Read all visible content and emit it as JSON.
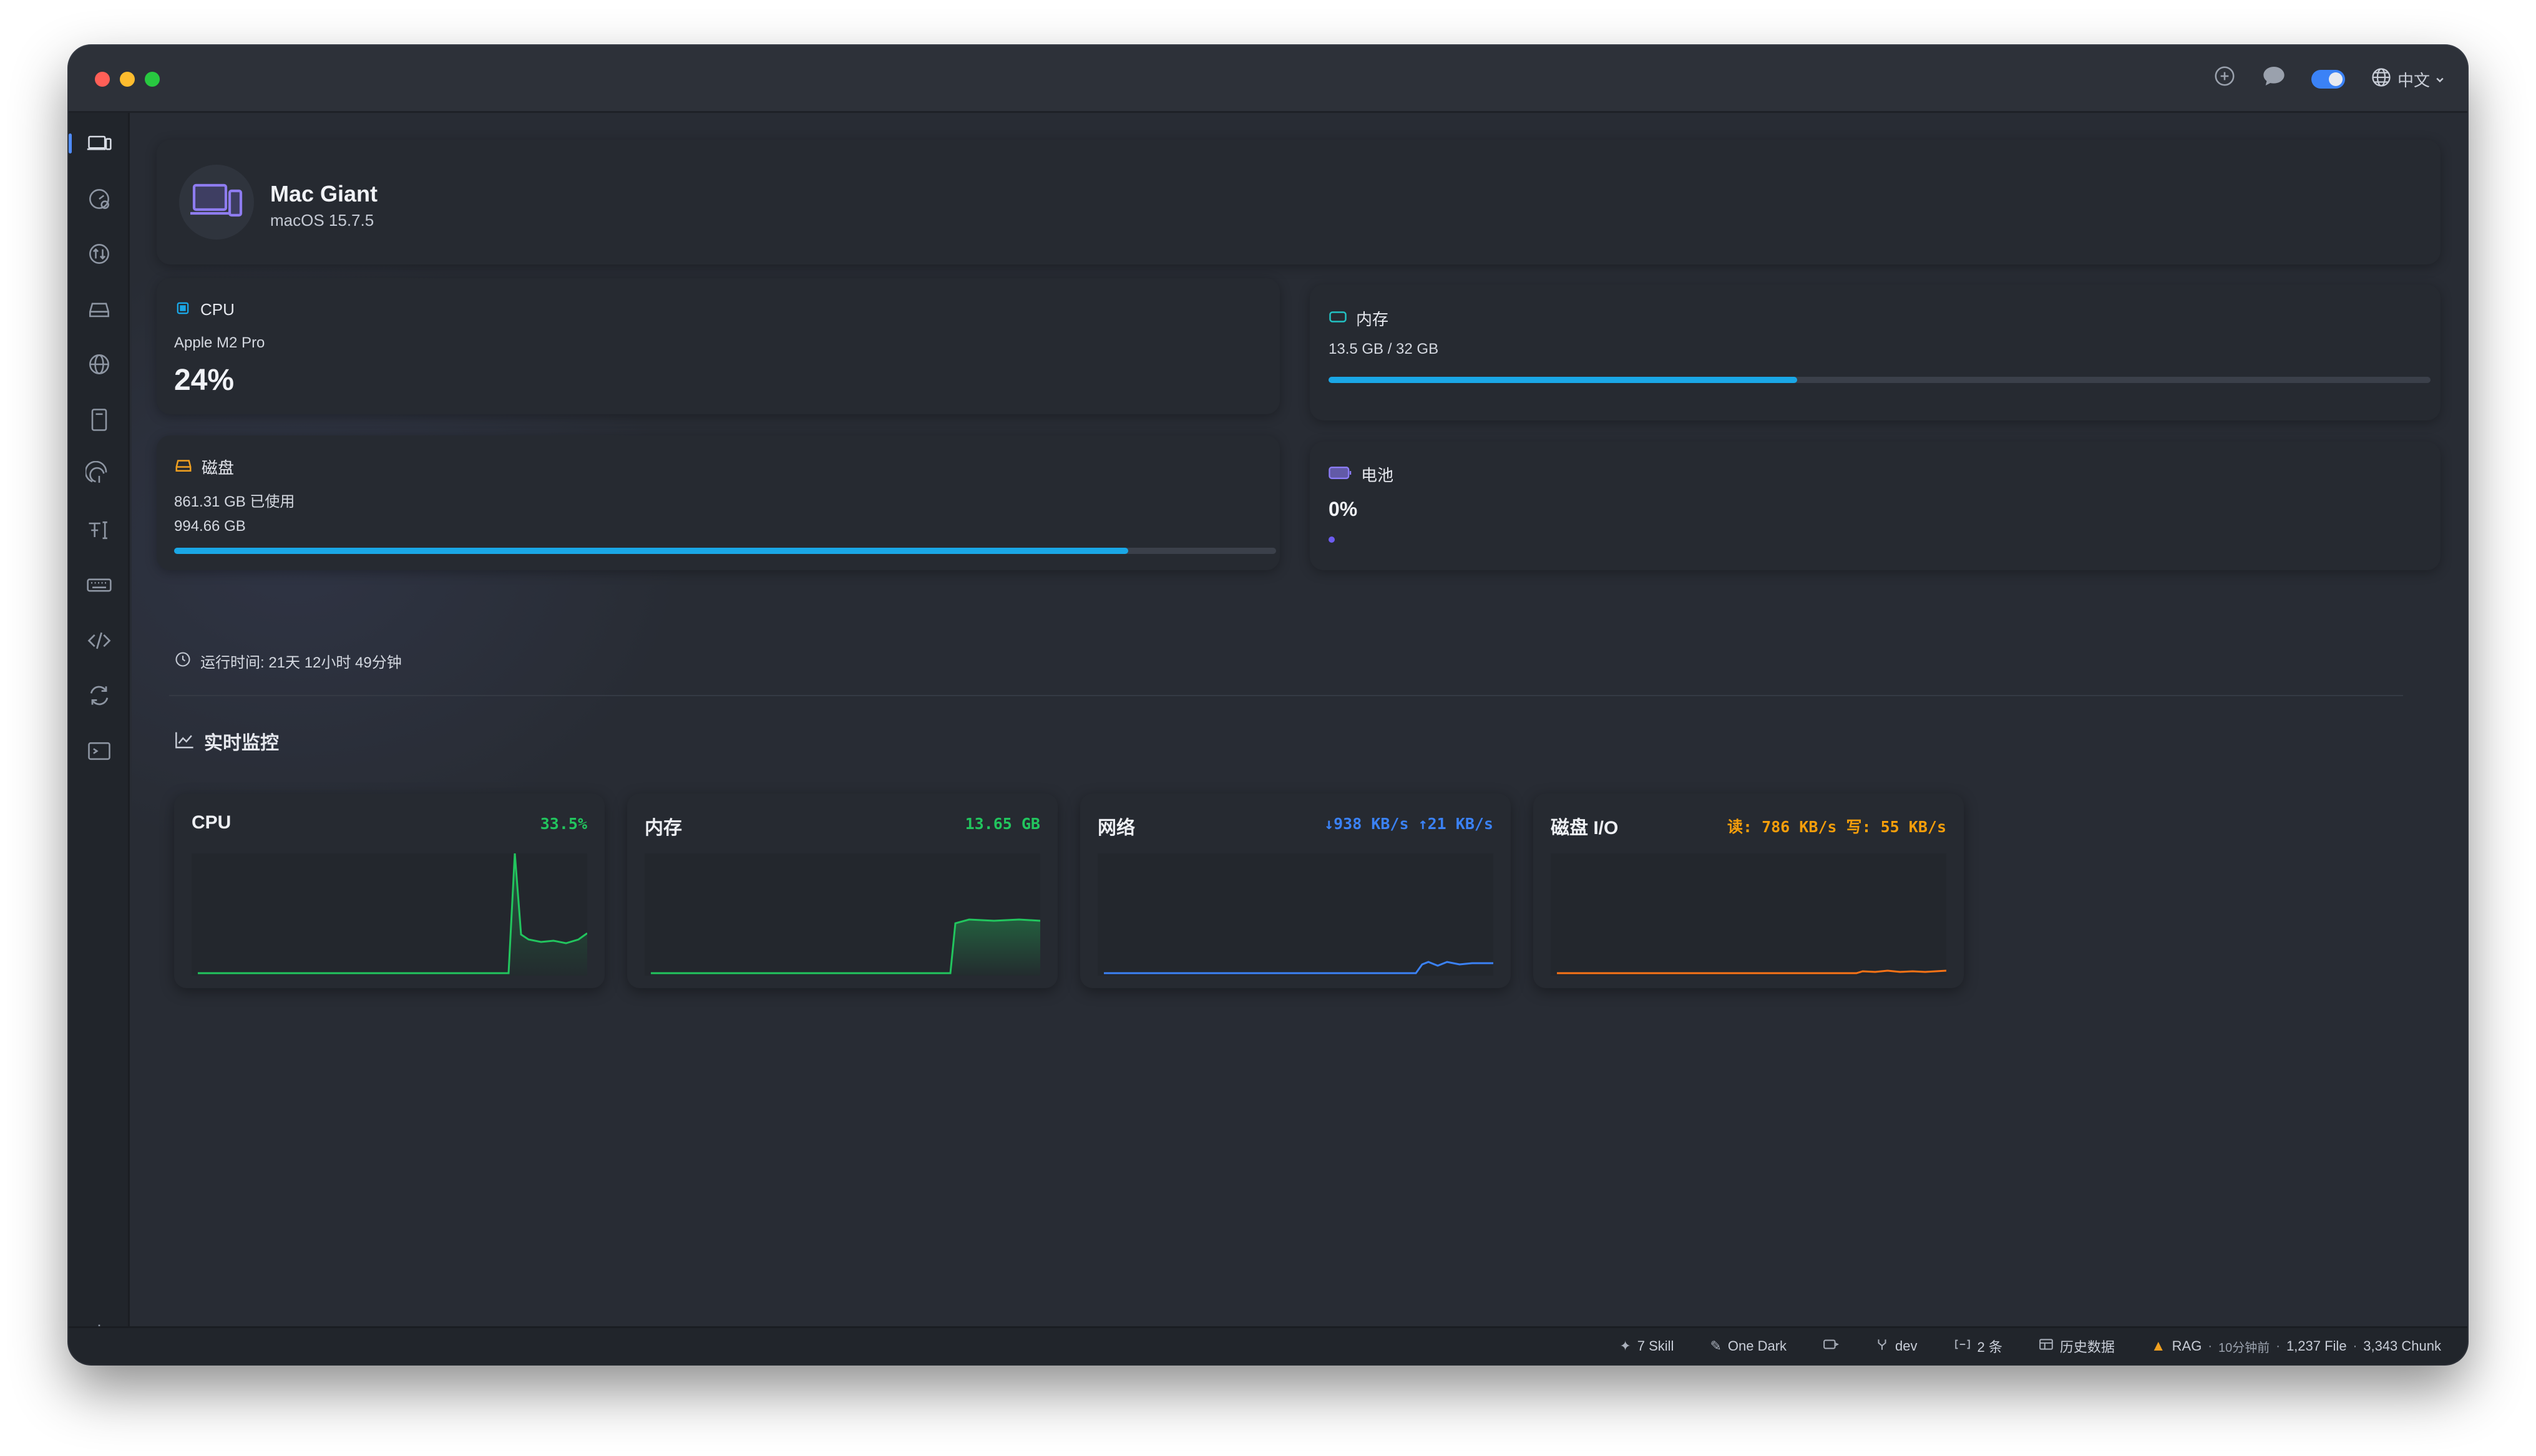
{
  "titlebar": {
    "language_label": "中文"
  },
  "device": {
    "name": "Mac Giant",
    "os": "macOS 15.7.5"
  },
  "cpu": {
    "title": "CPU",
    "model": "Apple M2 Pro",
    "usage": "24%"
  },
  "memory": {
    "title": "内存",
    "usage_text": "13.5 GB / 32 GB",
    "used_gb": 13.5,
    "total_gb": 32,
    "fill": 0.425
  },
  "disk": {
    "title": "磁盘",
    "used_text": "861.31 GB 已使用",
    "total_text": "994.66 GB",
    "fill": 0.866
  },
  "battery": {
    "title": "电池",
    "level": "0%",
    "fill": 0
  },
  "uptime": {
    "text": "运行时间: 21天 12小时 49分钟"
  },
  "monitor": {
    "section_title": "实时监控",
    "cards": [
      {
        "title": "CPU",
        "value": "33.5%",
        "color": "#22c55e"
      },
      {
        "title": "内存",
        "value": "13.65 GB",
        "color": "#22c55e"
      },
      {
        "title": "网络",
        "value": "↓938 KB/s ↑21 KB/s",
        "color": "#3b82f6"
      },
      {
        "title": "磁盘 I/O",
        "value": "读: 786 KB/s 写: 55 KB/s",
        "color": "#f59e0b"
      }
    ]
  },
  "statusbar": {
    "skill": "7 Skill",
    "theme": "One Dark",
    "branch": "dev",
    "count": "2 条",
    "history": "历史数据",
    "rag": "RAG",
    "rag_time": "10分钟前",
    "rag_files": "1,237 File",
    "rag_chunks": "3,343 Chunk"
  },
  "colors": {
    "accent": "#1aa7e6",
    "green": "#22c55e",
    "blue": "#3b82f6",
    "orange": "#f59e0b"
  }
}
